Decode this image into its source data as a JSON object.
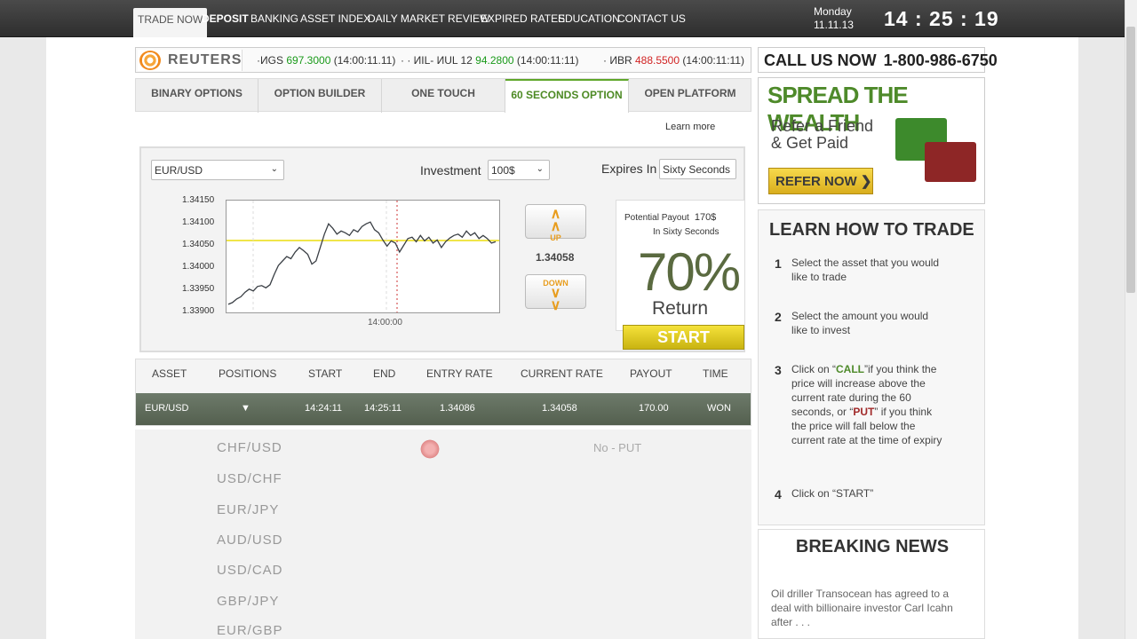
{
  "nav": {
    "items": [
      "TRADE NOW",
      "DEPOSIT",
      "BANKING",
      "ASSET INDEX",
      "DAILY MARKET REVIEW",
      "EXPIRED RATES",
      "EDUCATION",
      "CONTACT US"
    ],
    "date_day": "Monday",
    "date": "11.11.13",
    "time": "14 : 25 : 19"
  },
  "ticker": {
    "logo": "REUTERS",
    "items": [
      {
        "name": "·ИGS",
        "value": "697.3000",
        "time": "(14:00:11.11)",
        "dir": "up"
      },
      {
        "name": "· · ИIL- ИUL 12",
        "value": "94.2800",
        "time": "(14:00:11:11)",
        "dir": "up"
      },
      {
        "name": "· ИBR",
        "value": "488.5500",
        "time": "(14:00:11:11)",
        "dir": "down"
      }
    ]
  },
  "callus": {
    "label": "CALL US NOW",
    "phone": "1-800-986-6750"
  },
  "tabs": [
    "BINARY OPTIONS",
    "OPTION BUILDER",
    "ONE TOUCH",
    "60 SECONDS OPTION",
    "OPEN PLATFORM"
  ],
  "learn_more": "Learn more",
  "trade": {
    "asset": "EUR/USD",
    "investment_label": "Investment",
    "investment": "100$",
    "expires_label": "Expires In",
    "expires": "Sixty Seconds",
    "up_label": "UP",
    "down_label": "DOWN",
    "current_rate": "1.34058",
    "payout_label": "Potential Payout",
    "payout_value": "170$",
    "payout_sub": "In Sixty Seconds",
    "return_pct": "70%",
    "return_label": "Return",
    "start": "START",
    "chart_x_label": "14:00:00"
  },
  "chart_data": {
    "type": "line",
    "yticks": [
      "1.34150",
      "1.34100",
      "1.34050",
      "1.34000",
      "1.33950",
      "1.33900"
    ],
    "ylim": [
      1.339,
      1.3415
    ],
    "values": [
      1.33918,
      1.33922,
      1.3393,
      1.33935,
      1.33945,
      1.33952,
      1.33948,
      1.33958,
      1.3396,
      1.33955,
      1.33962,
      1.33985,
      1.34005,
      1.34015,
      1.34025,
      1.3402,
      1.34035,
      1.34045,
      1.34038,
      1.3403,
      1.34008,
      1.34015,
      1.34045,
      1.34075,
      1.34098,
      1.34088,
      1.34075,
      1.34082,
      1.34078,
      1.34072,
      1.34085,
      1.3408,
      1.34092,
      1.34098,
      1.34102,
      1.34085,
      1.34078,
      1.34062,
      1.34048,
      1.3406,
      1.34055,
      1.34035,
      1.3405,
      1.34065,
      1.34068,
      1.34058,
      1.34072,
      1.3406,
      1.34068,
      1.34055,
      1.34062,
      1.34045,
      1.34058,
      1.34066,
      1.34072,
      1.34075,
      1.34068,
      1.34082,
      1.34072,
      1.34078,
      1.34065,
      1.34072,
      1.34065,
      1.34055,
      1.34058
    ]
  },
  "positions": {
    "headers": [
      "ASSET",
      "POSITIONS",
      "START",
      "END",
      "ENTRY RATE",
      "CURRENT RATE",
      "PAYOUT",
      "TIME"
    ],
    "row": [
      "EUR/USD",
      "▼",
      "14:24:11",
      "14:25:11",
      "1.34086",
      "1.34058",
      "170.00",
      "WON"
    ]
  },
  "asset_list": [
    "CHF/USD",
    "USD/CHF",
    "EUR/JPY",
    "AUD/USD",
    "USD/CAD",
    "GBP/JPY",
    "EUR/GBP"
  ],
  "no_put": "No - PUT",
  "refer": {
    "heading": "SPREAD THE WEALTH",
    "sub1": "Refer a Friend",
    "sub2": "& Get Paid",
    "button": "REFER NOW ❯"
  },
  "learn": {
    "heading": "LEARN HOW TO TRADE",
    "steps": [
      {
        "n": "1",
        "text": "Select the asset that you would like to trade"
      },
      {
        "n": "2",
        "text": "Select the amount you would like to invest"
      },
      {
        "n": "3",
        "pre": "Click on “",
        "call": "CALL",
        "mid": "”if you think the price will increase above the current rate during the 60 seconds, or “",
        "put": "PUT",
        "post": "” if you think the price will fall below the current rate at the time of expiry"
      },
      {
        "n": "4",
        "text": "Click on “START”"
      }
    ]
  },
  "news": {
    "heading": "BREAKING NEWS",
    "text": "Oil driller Transocean has agreed to a deal with billionaire investor Carl Icahn after . . ."
  }
}
